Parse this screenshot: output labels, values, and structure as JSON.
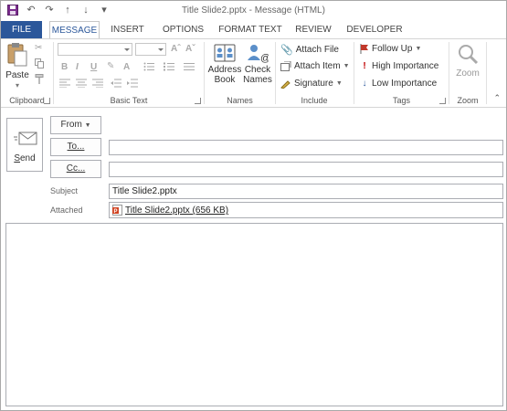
{
  "window": {
    "title": "Title Slide2.pptx - Message (HTML)"
  },
  "tabs": [
    "FILE",
    "MESSAGE",
    "INSERT",
    "OPTIONS",
    "FORMAT TEXT",
    "REVIEW",
    "DEVELOPER"
  ],
  "ribbon": {
    "clipboard": {
      "label": "Clipboard",
      "paste": "Paste"
    },
    "basic_text": {
      "label": "Basic Text",
      "bold": "B",
      "italic": "I",
      "underline": "U"
    },
    "names": {
      "label": "Names",
      "address_book": [
        "Address",
        "Book"
      ],
      "check_names": [
        "Check",
        "Names"
      ]
    },
    "include": {
      "label": "Include",
      "attach_file": "Attach File",
      "attach_item": "Attach Item",
      "signature": "Signature"
    },
    "tags": {
      "label": "Tags",
      "follow_up": "Follow Up",
      "high_importance": "High Importance",
      "low_importance": "Low Importance"
    },
    "zoom": {
      "label": "Zoom",
      "zoom_btn": "Zoom"
    }
  },
  "compose": {
    "send": "Send",
    "from": "From",
    "to": "To...",
    "cc": "Cc...",
    "subject_label": "Subject",
    "subject_value": "Title Slide2.pptx",
    "attached_label": "Attached",
    "attachment": "Title Slide2.pptx (656 KB)"
  },
  "colors": {
    "accent": "#2b579a",
    "follow_up_flag": "#c1392b",
    "high_importance": "#c00000",
    "low_importance": "#2b579a",
    "ppt_icon": "#d04423"
  }
}
